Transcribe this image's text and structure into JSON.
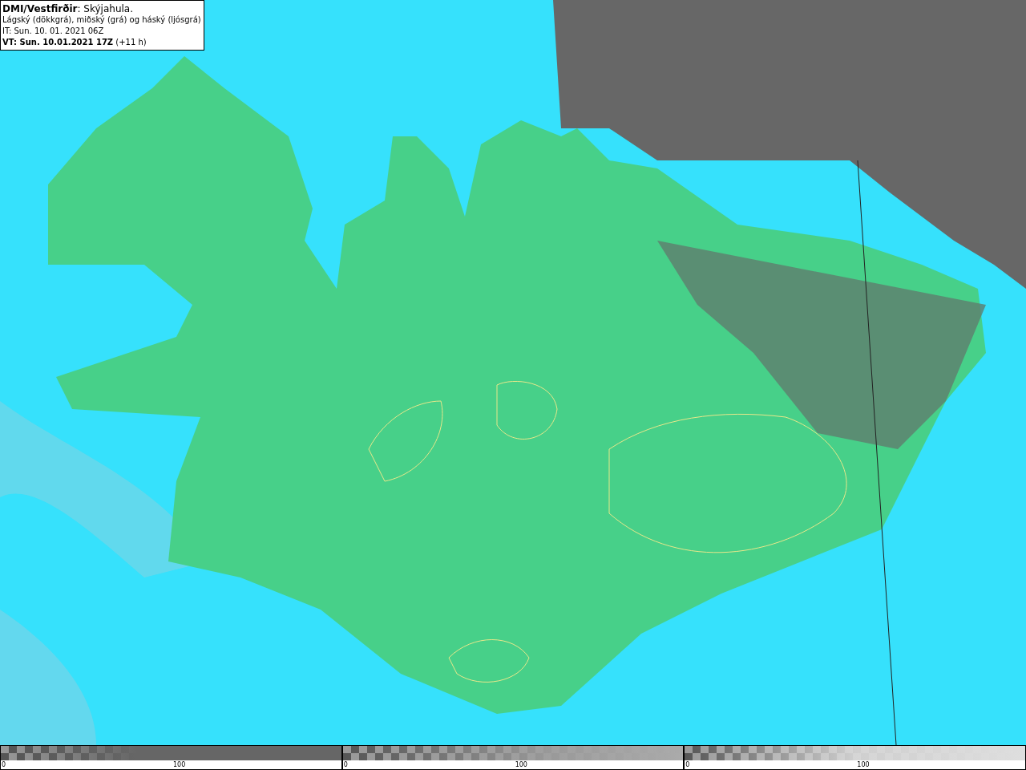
{
  "legend": {
    "lines": [
      "**DMI/Vestfirðir**: Skýjahula.",
      "Lágský (dökkgrá), miðský (grá) og háský (ljósgrá)",
      "IT: Sun. 10. 01. 2021 06Z",
      "**VT: Sun. 10.01.2021 17Z** (+11 h)"
    ]
  },
  "colorbars": [
    {
      "kind": "low",
      "min_label": "0",
      "mid_label": "100"
    },
    {
      "kind": "mid",
      "min_label": "0",
      "mid_label": "100"
    },
    {
      "kind": "high",
      "min_label": "0",
      "mid_label": "100"
    }
  ]
}
